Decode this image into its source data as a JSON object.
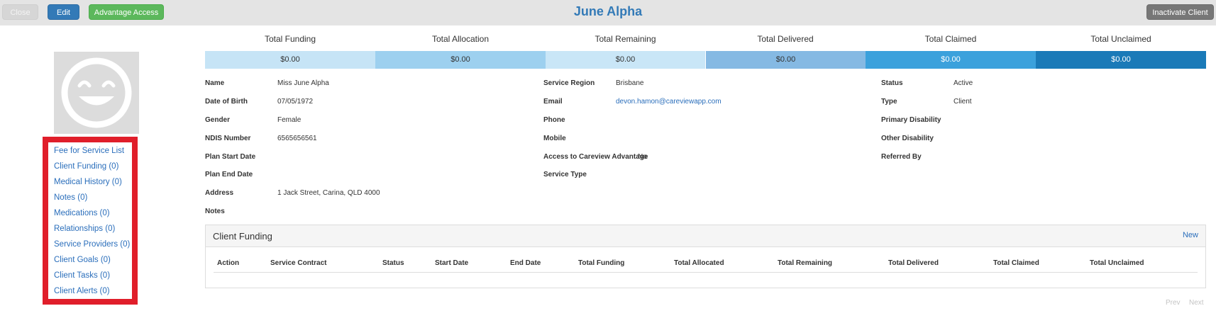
{
  "header": {
    "close_label": "Close",
    "edit_label": "Edit",
    "advantage_label": "Advantage Access",
    "inactivate_label": "Inactivate Client",
    "title": "June Alpha"
  },
  "sidebar": {
    "items": [
      {
        "label": "Fee for Service List"
      },
      {
        "label": "Client Funding (0)"
      },
      {
        "label": "Medical History (0)"
      },
      {
        "label": "Notes (0)"
      },
      {
        "label": "Medications (0)"
      },
      {
        "label": "Relationships (0)"
      },
      {
        "label": "Service Providers (0)"
      },
      {
        "label": "Client Goals (0)"
      },
      {
        "label": "Client Tasks (0)"
      },
      {
        "label": "Client Alerts (0)"
      }
    ]
  },
  "totals": [
    {
      "label": "Total Funding",
      "value": "$0.00",
      "color": "#c6e4f6"
    },
    {
      "label": "Total Allocation",
      "value": "$0.00",
      "color": "#9dd0ef"
    },
    {
      "label": "Total Remaining",
      "value": "$0.00",
      "color": "#c9e6f7"
    },
    {
      "label": "Total Delivered",
      "value": "$0.00",
      "color": "#85b9e3"
    },
    {
      "label": "Total Claimed",
      "value": "$0.00",
      "color": "#3ba1dc"
    },
    {
      "label": "Total Unclaimed",
      "value": "$0.00",
      "color": "#1a7ab8"
    }
  ],
  "details": {
    "col1": [
      {
        "label": "Name",
        "value": "Miss June Alpha"
      },
      {
        "label": "Date of Birth",
        "value": "07/05/1972"
      },
      {
        "label": "Gender",
        "value": "Female"
      },
      {
        "label": "NDIS Number",
        "value": "6565656561"
      },
      {
        "label": "Plan Start Date",
        "value": ""
      },
      {
        "label": "Plan End Date",
        "value": ""
      },
      {
        "label": "Address",
        "value": "1 Jack Street, Carina, QLD 4000"
      },
      {
        "label": "Notes",
        "value": ""
      }
    ],
    "col2": [
      {
        "label": "Service Region",
        "value": "Brisbane"
      },
      {
        "label": "Email",
        "value": "devon.hamon@careviewapp.com"
      },
      {
        "label": "Phone",
        "value": ""
      },
      {
        "label": "Mobile",
        "value": ""
      },
      {
        "label": "Access to Careview Advantage",
        "value": "No"
      },
      {
        "label": "Service Type",
        "value": ""
      }
    ],
    "col3": [
      {
        "label": "Status",
        "value": "Active"
      },
      {
        "label": "Type",
        "value": "Client"
      },
      {
        "label": "Primary Disability",
        "value": ""
      },
      {
        "label": "Other Disability",
        "value": ""
      },
      {
        "label": "Referred By",
        "value": ""
      }
    ]
  },
  "funding_panel": {
    "title": "Client Funding",
    "new_label": "New",
    "columns": [
      "Action",
      "Service Contract",
      "Status",
      "Start Date",
      "End Date",
      "Total Funding",
      "Total Allocated",
      "Total Remaining",
      "Total Delivered",
      "Total Claimed",
      "Total Unclaimed"
    ]
  },
  "pager": {
    "prev_label": "Prev",
    "next_label": "Next"
  }
}
